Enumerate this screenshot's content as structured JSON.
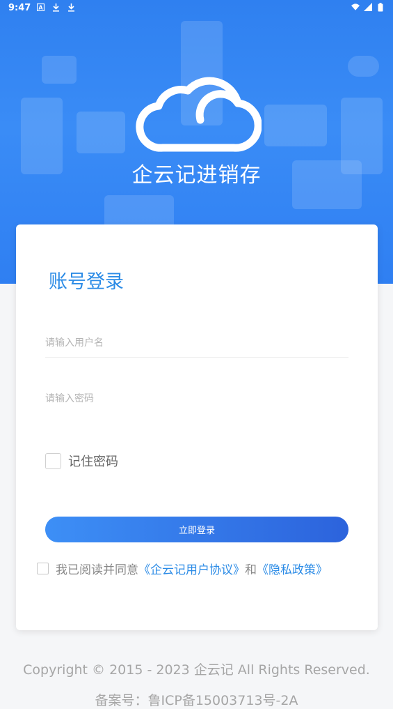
{
  "status_bar": {
    "time": "9:47",
    "left_icons": [
      "notification-a-icon",
      "download-icon",
      "download-icon"
    ],
    "right_icons": [
      "wifi-icon",
      "signal-icon",
      "battery-icon"
    ]
  },
  "header": {
    "logo_icon": "cloud-icon",
    "brand_name": "企云记进销存"
  },
  "login": {
    "title": "账号登录",
    "username_placeholder": "请输入用户名",
    "password_placeholder": "请输入密码",
    "remember_label": "记住密码",
    "submit_label": "立即登录",
    "agreement_prefix": "我已阅读并同意",
    "user_agreement_link": "《企云记用户协议》",
    "agreement_and": "和",
    "privacy_link": "《隐私政策》"
  },
  "footer": {
    "copyright": "Copyright © 2015 - 2023 企云记 All Rights Reserved.",
    "icp": "备案号：鲁ICP备15003713号-2A"
  },
  "colors": {
    "primary": "#2f80f0",
    "accent_text": "#2b8be6",
    "button_start": "#3d8ff6",
    "button_end": "#2c63dc"
  }
}
